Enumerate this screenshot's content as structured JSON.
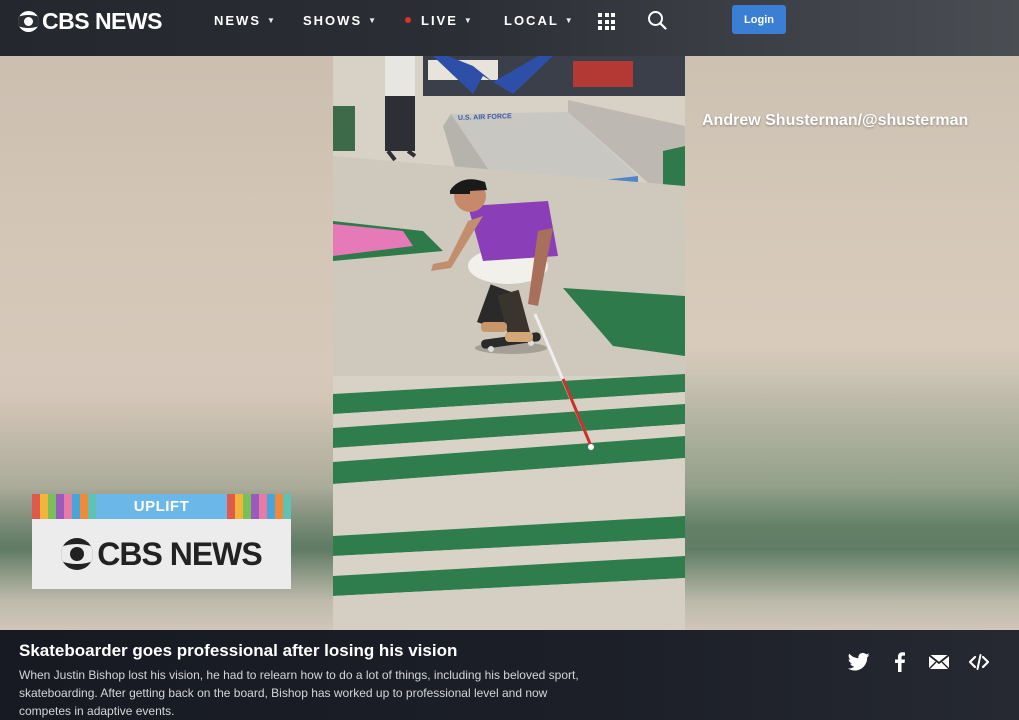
{
  "brand": {
    "logo_text": "CBS NEWS"
  },
  "nav": {
    "items": [
      {
        "label": "NEWS"
      },
      {
        "label": "SHOWS"
      },
      {
        "label": "LIVE"
      },
      {
        "label": "LOCAL"
      }
    ],
    "login_label": "Login"
  },
  "video": {
    "credit": "Andrew Shusterman/@shusterman",
    "signage_text": "U.S. AIR FORCE"
  },
  "bug": {
    "top_label": "UPLIFT",
    "logo_text": "CBS NEWS"
  },
  "caption": {
    "title": "Skateboarder goes professional after losing his vision",
    "description": "When Justin Bishop lost his vision, he had to relearn how to do a lot of things, including his beloved sport, skateboarding. After getting back on the board, Bishop has worked up to professional level and now competes in adaptive events."
  },
  "icons": {
    "share": [
      "twitter-icon",
      "facebook-icon",
      "email-icon",
      "embed-icon"
    ],
    "nav": [
      "apps-grid-icon",
      "search-icon"
    ]
  },
  "colors": {
    "login_button": "#3b7fd4",
    "live_dot": "#e0302b",
    "ramp_green": "#2e7a4a",
    "caption_bg": "#1a1d24"
  }
}
